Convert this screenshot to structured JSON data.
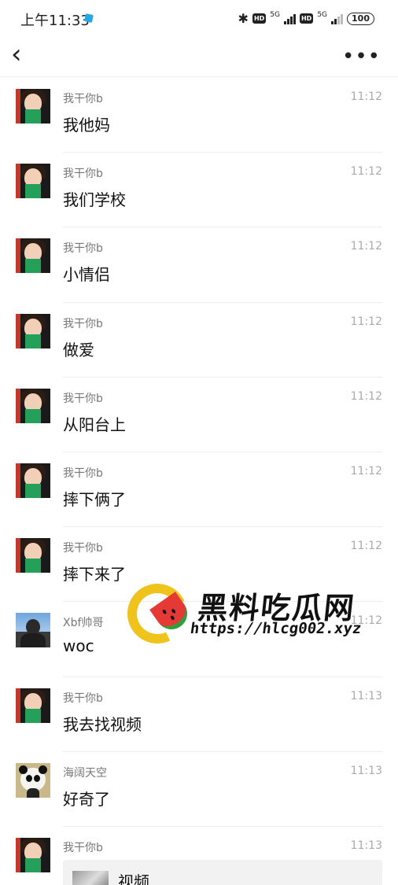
{
  "status": {
    "time": "上午11:33",
    "bluetooth": "✱",
    "hd1": "HD",
    "net1": "5G",
    "hd2": "HD",
    "net2": "5G",
    "battery": "100"
  },
  "nav": {
    "back": "‹",
    "more": "•••"
  },
  "messages": [
    {
      "name": "我干你b",
      "time": "11:12",
      "text": "我他妈",
      "avatar": "girl"
    },
    {
      "name": "我干你b",
      "time": "11:12",
      "text": "我们学校",
      "avatar": "girl"
    },
    {
      "name": "我干你b",
      "time": "11:12",
      "text": "小情侣",
      "avatar": "girl"
    },
    {
      "name": "我干你b",
      "time": "11:12",
      "text": "做爱",
      "avatar": "girl"
    },
    {
      "name": "我干你b",
      "time": "11:12",
      "text": "从阳台上",
      "avatar": "girl"
    },
    {
      "name": "我干你b",
      "time": "11:12",
      "text": "摔下俩了",
      "avatar": "girl"
    },
    {
      "name": "我干你b",
      "time": "11:12",
      "text": "摔下来了",
      "avatar": "girl"
    },
    {
      "name": "Xbf帅哥",
      "time": "11:12",
      "text": "woc",
      "avatar": "man"
    },
    {
      "name": "我干你b",
      "time": "11:13",
      "text": "我去找视频",
      "avatar": "girl"
    },
    {
      "name": "海阔天空",
      "time": "11:13",
      "text": "好奇了",
      "avatar": "panda"
    },
    {
      "name": "我干你b",
      "time": "11:13",
      "text": "",
      "avatar": "girl"
    }
  ],
  "video_card": {
    "label": "视频"
  },
  "watermark": {
    "title": "黑料吃瓜网",
    "url": "https://hlcg002.xyz"
  }
}
